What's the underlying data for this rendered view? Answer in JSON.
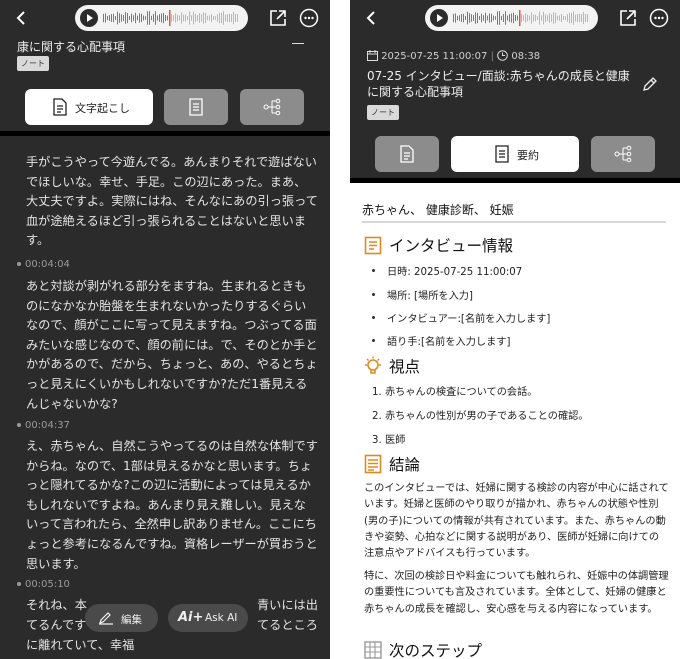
{
  "left": {
    "title_partial": "康に関する心配事項",
    "note_badge": "ノート",
    "tabs": {
      "transcript_label": "文字起こし"
    },
    "blocks": [
      {
        "text": "手がこうやって今遊んでる。あんまりそれで遊ばないでほしいな。幸せ、手足。この辺にあった。まあ、大丈夫ですよ。実際にはね、そんなにあの引っ張って血が途絶えるほど引っ張られることはないと思います。"
      },
      {
        "time": "00:04:04",
        "text": "あと対談が剥がれる部分をますね。生まれるときものになかなか胎盤を生まれないかったりするぐらいなので、顔がここに写って見えますね。つぶってる面みたいな感じなので、顔の前には。で、そのとか手とかがあるので、だから、ちょっと、あの、やるとちょっと見えにくいかもしれないですか?ただ1番見えるんじゃないかな?"
      },
      {
        "time": "00:04:37",
        "text": "え、赤ちゃん、自然こうやってるのは自然な体制ですからね。なので、1部は見えるかなと思います。ちょっと隠れてるかな?この辺に活動によっては見えるかもしれないですよね。あんまり見え難しい。見えないって言われたら、全然申し訳ありません。ここにちょっと参考になるんですね。資格レーザーが買おうと思います。"
      },
      {
        "time": "00:05:10",
        "line1a": "それね、本",
        "line1b": "青いには出",
        "line2a": "てるんです",
        "line2b": "てるところ",
        "line3": "に離れていて、幸福"
      }
    ],
    "buttons": {
      "edit": "編集",
      "ask_ai": "Ask AI"
    }
  },
  "right": {
    "datetime": "2025-07-25 11:00:07",
    "duration": "08:38",
    "title": "07-25 インタビュー/面談:赤ちゃんの成長と健康に関する心配事項",
    "note_badge": "ノート",
    "tabs": {
      "summary_label": "要約"
    },
    "keywords": "赤ちゃん、 健康診断、 妊娠",
    "sections": {
      "interview_info": {
        "heading": "インタビュー情報",
        "items": [
          "日時: 2025-07-25 11:00:07",
          "場所: [場所を入力]",
          "インタビュアー:[名前を入力します]",
          "語り手:[名前を入力します]"
        ]
      },
      "perspective": {
        "heading": "視点",
        "items": [
          "1. 赤ちゃんの検査についての会話。",
          "2. 赤ちゃんの性別が男の子であることの確認。",
          "3. 医師"
        ]
      },
      "conclusion": {
        "heading": "結論",
        "para1": "このインタビューでは、妊婦に関する検診の内容が中心に話されています。妊婦と医師のやり取りが描かれ、赤ちゃんの状態や性別(男の子)についての情報が共有されています。また、赤ちゃんの動きや姿勢、心拍などに関する説明があり、医師が妊婦に向けての注意点やアドバイスも行っています。",
        "para2": "特に、次回の検診日や料金についても触れられ、妊娠中の体調管理の重要性についても言及されています。全体として、妊婦の健康と赤ちゃんの成長を確認し、安心感を与える内容になっています。"
      },
      "next_steps": {
        "heading": "次のステップ"
      }
    }
  },
  "colors": {
    "panel_bg": "#2b2b2b",
    "accent_orange": "#e08a1e",
    "wave_red": "#d9534f"
  }
}
